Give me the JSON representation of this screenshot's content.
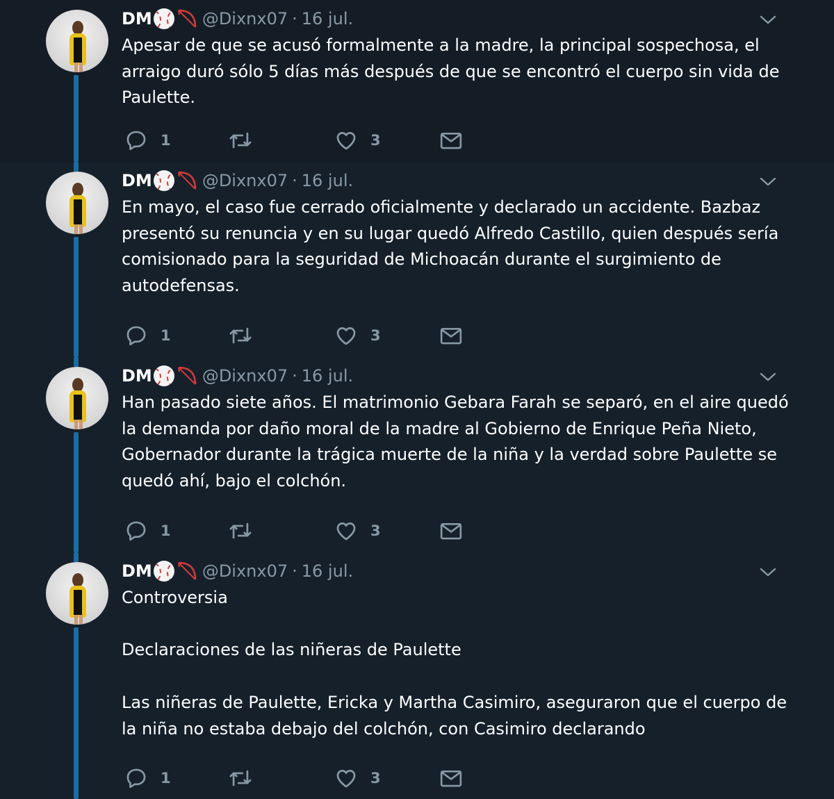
{
  "tweets": [
    {
      "author_name": "DM",
      "emojis": [
        "baseball-emoji",
        "bow-and-arrow-emoji"
      ],
      "handle": "@Dixnx07",
      "separator": "·",
      "date": "16 jul.",
      "text": "Apesar de que se acusó formalmente a la madre, la principal sospechosa, el arraigo duró sólo 5 días más después de que se encontró el cuerpo sin vida de Paulette.",
      "replies": "1",
      "retweets": "",
      "likes": "3"
    },
    {
      "author_name": "DM",
      "emojis": [
        "baseball-emoji",
        "bow-and-arrow-emoji"
      ],
      "handle": "@Dixnx07",
      "separator": "·",
      "date": "16 jul.",
      "text": "En mayo, el caso fue cerrado oficialmente y declarado un accidente. Bazbaz presentó su renuncia y en su lugar quedó Alfredo Castillo, quien después sería comisionado para la seguridad de Michoacán durante el surgimiento de autodefensas.",
      "replies": "1",
      "retweets": "",
      "likes": "3"
    },
    {
      "author_name": "DM",
      "emojis": [
        "baseball-emoji",
        "bow-and-arrow-emoji"
      ],
      "handle": "@Dixnx07",
      "separator": "·",
      "date": "16 jul.",
      "text": "Han pasado siete años. El matrimonio Gebara Farah se separó, en el aire quedó la demanda por daño moral de la madre al Gobierno de Enrique Peña Nieto, Gobernador durante la trágica muerte de la niña y la verdad sobre Paulette se quedó ahí, bajo el colchón.",
      "replies": "1",
      "retweets": "",
      "likes": "3"
    },
    {
      "author_name": "DM",
      "emojis": [
        "baseball-emoji",
        "bow-and-arrow-emoji"
      ],
      "handle": "@Dixnx07",
      "separator": "·",
      "date": "16 jul.",
      "text": "Controversia\n\nDeclaraciones de las niñeras de Paulette\n\nLas niñeras de Paulette, Ericka y Martha Casimiro, aseguraron que el cuerpo de la niña no estaba debajo del colchón, con Casimiro declarando",
      "replies": "1",
      "retweets": "",
      "likes": "3"
    }
  ],
  "icons": {
    "reply": "reply-icon",
    "retweet": "retweet-icon",
    "like": "heart-icon",
    "dm": "envelope-icon",
    "menu": "chevron-down-icon"
  },
  "colors": {
    "background": "#15202b",
    "background_highlight": "#141d26",
    "text_primary": "#ffffff",
    "text_secondary": "#8899a6",
    "thread_line": "#1a6da0"
  }
}
